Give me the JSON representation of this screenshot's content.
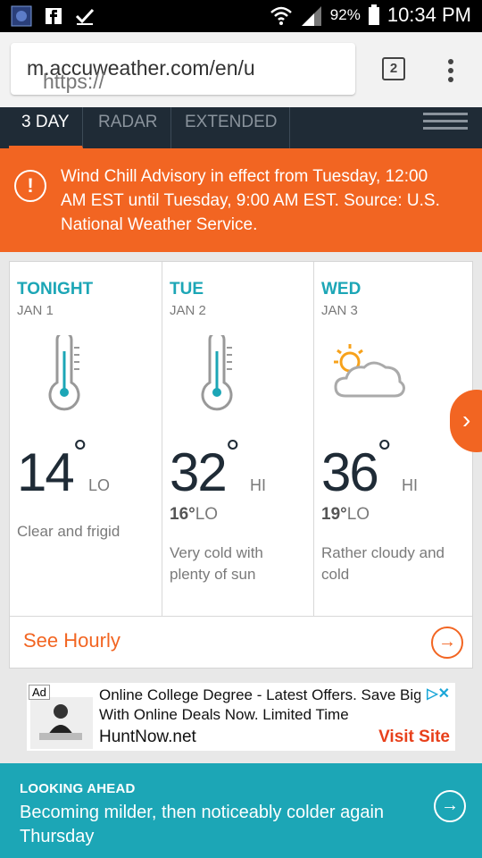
{
  "status_bar": {
    "battery": "92%",
    "time": "10:34 PM"
  },
  "browser": {
    "url_scheme": "https://",
    "url_host": "m.accuweather.com/en/u",
    "tab_count": "2"
  },
  "nav": {
    "tabs": [
      "3 DAY",
      "RADAR",
      "EXTENDED"
    ]
  },
  "alert": {
    "text": "Wind Chill Advisory in effect from Tuesday, 12:00 AM EST until Tuesday, 9:00 AM EST. Source: U.S. National Weather Service."
  },
  "forecast": [
    {
      "day": "TONIGHT",
      "date": "JAN 1",
      "temp": "14",
      "temp_type": "LO",
      "low": "",
      "desc": "Clear and frigid",
      "icon": "thermometer-icon"
    },
    {
      "day": "TUE",
      "date": "JAN 2",
      "temp": "32",
      "temp_type": "HI",
      "low": "16°",
      "low_label": "LO",
      "desc": "Very cold with plenty of sun",
      "icon": "thermometer-icon"
    },
    {
      "day": "WED",
      "date": "JAN 3",
      "temp": "36",
      "temp_type": "HI",
      "low": "19°",
      "low_label": "LO",
      "desc": "Rather cloudy and cold",
      "icon": "partly-cloudy-icon"
    }
  ],
  "hourly": {
    "label": "See Hourly"
  },
  "ad": {
    "label": "Ad",
    "line1": "Online College Degree - Latest Offers. Save Big",
    "line2": "With Online Deals Now. Limited Time",
    "domain": "HuntNow.net",
    "cta": "Visit Site"
  },
  "looking_ahead": {
    "label": "LOOKING AHEAD",
    "text": "Becoming milder, then noticeably colder again Thursday"
  },
  "colors": {
    "accent": "#f26522",
    "teal": "#1ca6b6",
    "nav_bg": "#1f2b36"
  }
}
